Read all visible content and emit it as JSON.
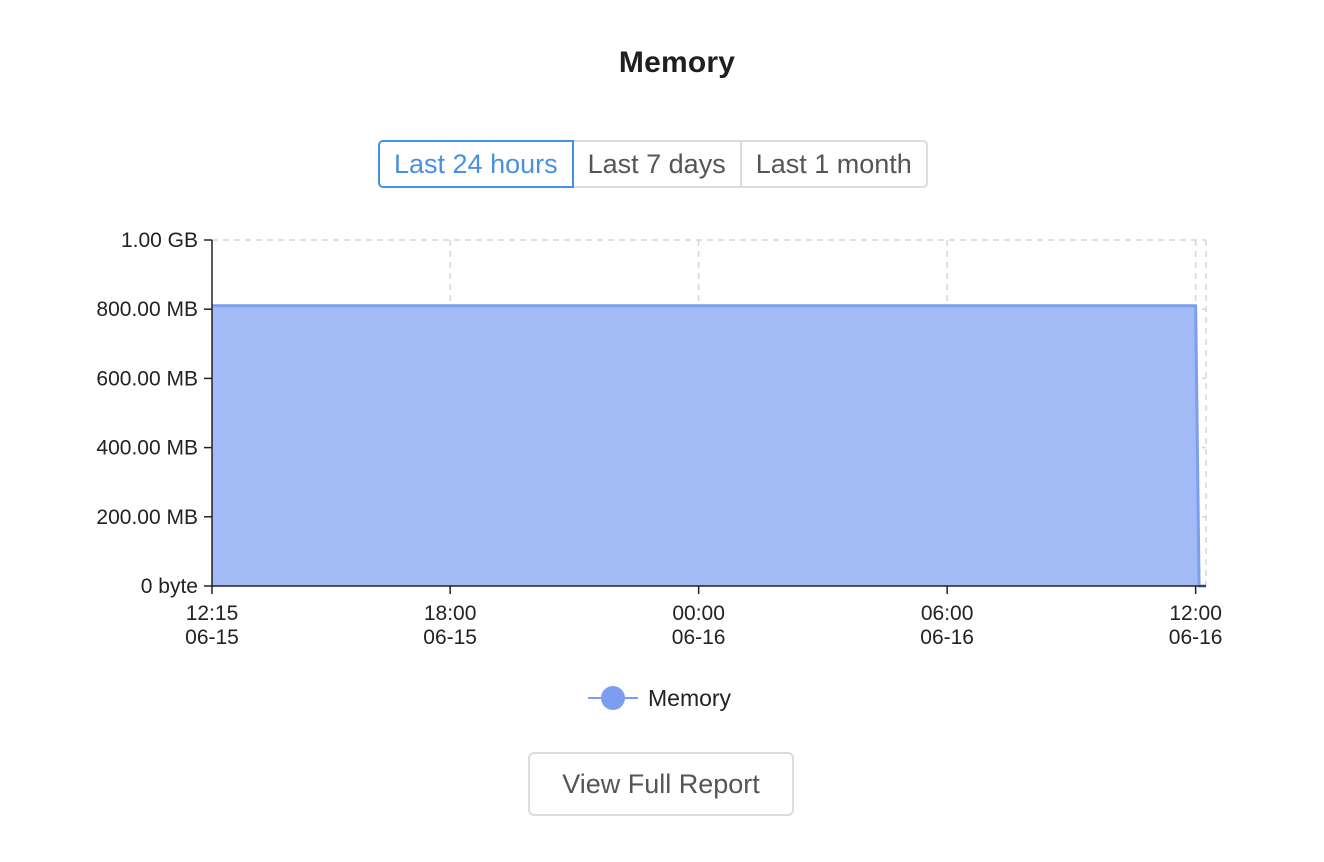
{
  "title": "Memory",
  "range_options": [
    {
      "label": "Last 24 hours",
      "active": true
    },
    {
      "label": "Last 7 days",
      "active": false
    },
    {
      "label": "Last 1 month",
      "active": false
    }
  ],
  "report_button": "View Full Report",
  "colors": {
    "accent": "#4a90e2",
    "series_line": "#7b9ef0",
    "series_fill": "#a2bbf7",
    "border": "#dcdcdc"
  },
  "chart_data": {
    "type": "area",
    "title": "Memory",
    "xlabel": "",
    "ylabel": "",
    "y_unit": "MB",
    "ylim": [
      0,
      1000
    ],
    "y_ticks": [
      {
        "value": 0,
        "label": "0 byte"
      },
      {
        "value": 200,
        "label": "200.00 MB"
      },
      {
        "value": 400,
        "label": "400.00 MB"
      },
      {
        "value": 600,
        "label": "600.00 MB"
      },
      {
        "value": 800,
        "label": "800.00 MB"
      },
      {
        "value": 1000,
        "label": "1.00 GB"
      }
    ],
    "x_ticks": [
      {
        "time": "06-15 12:15",
        "label": [
          "12:15",
          "06-15"
        ]
      },
      {
        "time": "06-15 18:00",
        "label": [
          "18:00",
          "06-15"
        ]
      },
      {
        "time": "06-16 00:00",
        "label": [
          "00:00",
          "06-16"
        ]
      },
      {
        "time": "06-16 06:00",
        "label": [
          "06:00",
          "06-16"
        ]
      },
      {
        "time": "06-16 12:00",
        "label": [
          "12:00",
          "06-16"
        ]
      }
    ],
    "x_start": "06-15 12:15",
    "x_end": "06-16 12:15",
    "grid": true,
    "legend_position": "bottom",
    "series": [
      {
        "name": "Memory",
        "points": [
          {
            "t": "06-15 12:15",
            "y": 810
          },
          {
            "t": "06-16 12:00",
            "y": 810
          },
          {
            "t": "06-16 12:05",
            "y": 0
          },
          {
            "t": "06-16 12:15",
            "y": 0
          }
        ]
      }
    ]
  }
}
